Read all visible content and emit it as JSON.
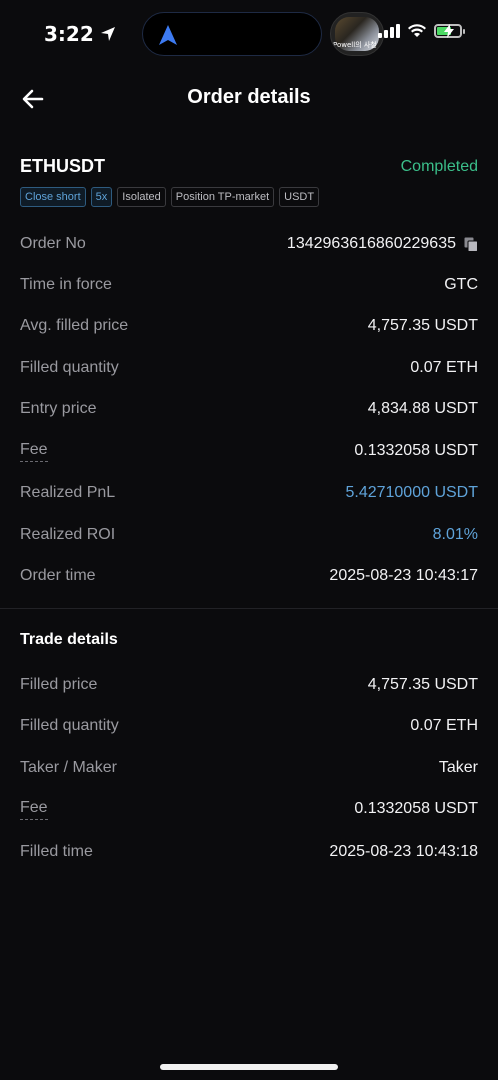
{
  "status_bar": {
    "time": "3:22",
    "media_caption": "Powell의 사철",
    "colors": {
      "battery": "#4cd964"
    }
  },
  "header": {
    "title": "Order details"
  },
  "order": {
    "symbol": "ETHUSDT",
    "status": "Completed",
    "tags": [
      "Close short",
      "5x",
      "Isolated",
      "Position TP-market",
      "USDT"
    ],
    "fields": [
      {
        "label": "Order No",
        "value": "1342963616860229635"
      },
      {
        "label": "Time in force",
        "value": "GTC"
      },
      {
        "label": "Avg. filled price",
        "value": "4,757.35 USDT"
      },
      {
        "label": "Filled quantity",
        "value": "0.07 ETH"
      },
      {
        "label": "Entry price",
        "value": "4,834.88 USDT"
      },
      {
        "label": "Fee",
        "value": "0.1332058 USDT"
      },
      {
        "label": "Realized PnL",
        "value": "5.42710000 USDT"
      },
      {
        "label": "Realized ROI",
        "value": "8.01%"
      },
      {
        "label": "Order time",
        "value": "2025-08-23 10:43:17"
      }
    ]
  },
  "trade": {
    "title": "Trade details",
    "fields": [
      {
        "label": "Filled price",
        "value": "4,757.35 USDT"
      },
      {
        "label": "Filled quantity",
        "value": "0.07 ETH"
      },
      {
        "label": "Taker / Maker",
        "value": "Taker"
      },
      {
        "label": "Fee",
        "value": "0.1332058 USDT"
      },
      {
        "label": "Filled time",
        "value": "2025-08-23 10:43:18"
      }
    ]
  },
  "colors": {
    "completed": "#3bbf8a",
    "accent_blue": "#5fa3d9",
    "background": "#0b0b0d"
  }
}
